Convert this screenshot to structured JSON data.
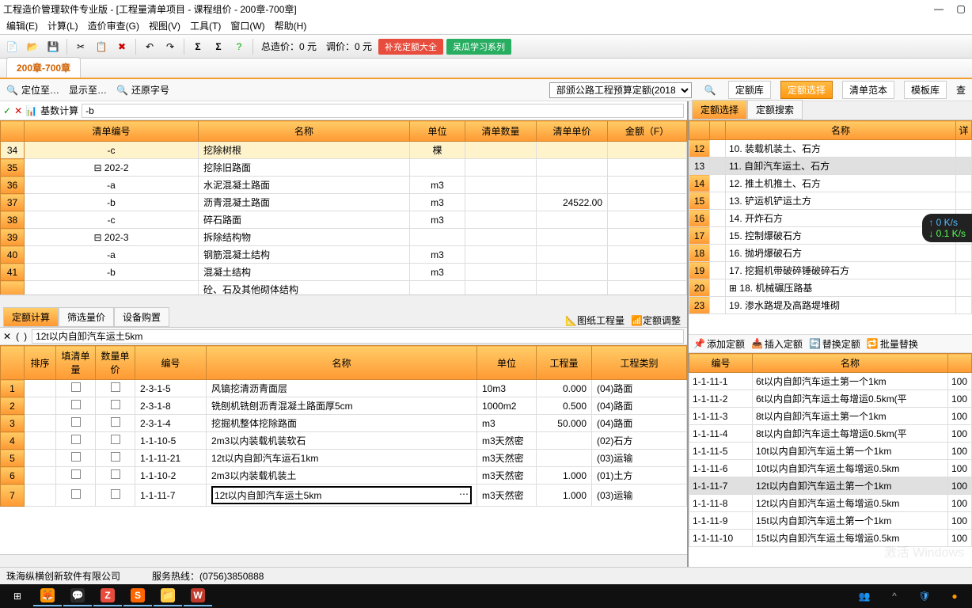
{
  "titlebar": {
    "title": "工程造价管理软件专业版 - [工程量清单项目 - 课程组价 - 200章-700章]"
  },
  "menu": [
    "编辑(E)",
    "计算(L)",
    "造价审查(G)",
    "视图(V)",
    "工具(T)",
    "窗口(W)",
    "帮助(H)"
  ],
  "toolbar": {
    "total_price": "总造价：0 元",
    "adj_price": "调价：0 元",
    "badge1": "补充定额大全",
    "badge2": "呆瓜学习系列"
  },
  "doctab": "200章-700章",
  "filterbar": {
    "locate": "定位至…",
    "show": "显示至…",
    "restore": "还原字号",
    "dropdown": "部颁公路工程预算定额(2018)",
    "btn_lib": "定额库",
    "btn_sel": "定额选择",
    "btn_tmpl1": "清单范本",
    "btn_tmpl2": "模板库",
    "btn_more": "查"
  },
  "formula": {
    "label": "基数计算",
    "value": "-b"
  },
  "maingrid": {
    "headers": [
      "",
      "清单编号",
      "名称",
      "单位",
      "清单数量",
      "清单单价",
      "金额（F）"
    ],
    "rows": [
      {
        "n": "34",
        "code": "-c",
        "name": "挖除树根",
        "unit": "棵",
        "qty": "",
        "price": "",
        "amt": "",
        "sel": true
      },
      {
        "n": "35",
        "code": "⊟ 202-2",
        "name": "挖除旧路面",
        "unit": "",
        "qty": "",
        "price": "",
        "amt": ""
      },
      {
        "n": "36",
        "code": "-a",
        "name": "水泥混凝土路面",
        "unit": "m3",
        "qty": "",
        "price": "",
        "amt": ""
      },
      {
        "n": "37",
        "code": "-b",
        "name": "沥青混凝土路面",
        "unit": "m3",
        "qty": "",
        "price": "24522.00",
        "amt": ""
      },
      {
        "n": "38",
        "code": "-c",
        "name": "碎石路面",
        "unit": "m3",
        "qty": "",
        "price": "",
        "amt": ""
      },
      {
        "n": "39",
        "code": "⊟ 202-3",
        "name": "拆除结构物",
        "unit": "",
        "qty": "",
        "price": "",
        "amt": ""
      },
      {
        "n": "40",
        "code": "-a",
        "name": "钢筋混凝土结构",
        "unit": "m3",
        "qty": "",
        "price": "",
        "amt": ""
      },
      {
        "n": "41",
        "code": "-b",
        "name": "混凝土结构",
        "unit": "m3",
        "qty": "",
        "price": "",
        "amt": ""
      },
      {
        "n": "",
        "code": "",
        "name": "砼、石及其他砌体结构",
        "unit": "",
        "qty": "",
        "price": "",
        "amt": ""
      }
    ]
  },
  "bottomtabs": {
    "tabs": [
      "定额计算",
      "筛选量价",
      "设备购置"
    ],
    "right1": "图纸工程量",
    "right2": "定额调整"
  },
  "calcbar": {
    "value": "12t以内自卸汽车运土5km"
  },
  "calcgrid": {
    "headers": [
      "排序",
      "填清单量",
      "数量单价",
      "编号",
      "名称",
      "单位",
      "工程量",
      "工程类别"
    ],
    "rows": [
      {
        "n": "1",
        "code": "2-3-1-5",
        "name": "风镐挖清沥青面层",
        "unit": "10m3",
        "qty": "0.000",
        "cat": "(04)路面"
      },
      {
        "n": "2",
        "code": "2-3-1-8",
        "name": "铣刨机铣刨沥青混凝土路面厚5cm",
        "unit": "1000m2",
        "qty": "0.500",
        "cat": "(04)路面"
      },
      {
        "n": "3",
        "code": "2-3-1-4",
        "name": "挖掘机整体挖除路面",
        "unit": "m3",
        "qty": "50.000",
        "cat": "(04)路面"
      },
      {
        "n": "4",
        "code": "1-1-10-5",
        "name": "2m3以内装载机装软石",
        "unit": "m3天然密",
        "qty": "",
        "cat": "(02)石方"
      },
      {
        "n": "5",
        "code": "1-1-11-21",
        "name": "12t以内自卸汽车运石1km",
        "unit": "m3天然密",
        "qty": "",
        "cat": "(03)运输"
      },
      {
        "n": "6",
        "code": "1-1-10-2",
        "name": "2m3以内装载机装土",
        "unit": "m3天然密",
        "qty": "1.000",
        "cat": "(01)土方"
      },
      {
        "n": "7",
        "code": "1-1-11-7",
        "name": "12t以内自卸汽车运土5km",
        "unit": "m3天然密",
        "qty": "1.000",
        "cat": "(03)运输",
        "edit": true
      }
    ]
  },
  "righttabs": [
    "定额选择",
    "定额搜索"
  ],
  "rightgrid1": {
    "header": "名称",
    "rows": [
      {
        "n": "12",
        "name": "10. 装载机装土、石方"
      },
      {
        "n": "13",
        "name": "11. 自卸汽车运土、石方",
        "sel": true
      },
      {
        "n": "14",
        "name": "12. 推土机推土、石方"
      },
      {
        "n": "15",
        "name": "13. 铲运机铲运土方"
      },
      {
        "n": "16",
        "name": "14. 开炸石方"
      },
      {
        "n": "17",
        "name": "15. 控制爆破石方"
      },
      {
        "n": "18",
        "name": "16. 抛坍爆破石方"
      },
      {
        "n": "19",
        "name": "17. 挖掘机带破碎锤破碎石方"
      },
      {
        "n": "20",
        "name": "⊞ 18. 机械碾压路基"
      },
      {
        "n": "23",
        "name": "19. 渗水路堤及高路堤堆砌"
      }
    ]
  },
  "righttoolbar": [
    "添加定额",
    "插入定额",
    "替换定额",
    "批量替换"
  ],
  "rightgrid2": {
    "headers": [
      "编号",
      "名称"
    ],
    "rows": [
      {
        "code": "1-1-11-1",
        "name": "6t以内自卸汽车运土第一个1km",
        "r": "100"
      },
      {
        "code": "1-1-11-2",
        "name": "6t以内自卸汽车运土每增运0.5km(平",
        "r": "100"
      },
      {
        "code": "1-1-11-3",
        "name": "8t以内自卸汽车运土第一个1km",
        "r": "100"
      },
      {
        "code": "1-1-11-4",
        "name": "8t以内自卸汽车运土每增运0.5km(平",
        "r": "100"
      },
      {
        "code": "1-1-11-5",
        "name": "10t以内自卸汽车运土第一个1km",
        "r": "100"
      },
      {
        "code": "1-1-11-6",
        "name": "10t以内自卸汽车运土每增运0.5km",
        "r": "100"
      },
      {
        "code": "1-1-11-7",
        "name": "12t以内自卸汽车运土第一个1km",
        "r": "100",
        "sel": true
      },
      {
        "code": "1-1-11-8",
        "name": "12t以内自卸汽车运土每增运0.5km",
        "r": "100"
      },
      {
        "code": "1-1-11-9",
        "name": "15t以内自卸汽车运土第一个1km",
        "r": "100"
      },
      {
        "code": "1-1-11-10",
        "name": "15t以内自卸汽车运土每增运0.5km",
        "r": "100"
      }
    ]
  },
  "statusbar": {
    "company": "珠海纵横创新软件有限公司",
    "hotline": "服务热线：(0756)3850888"
  },
  "speed": {
    "up": "↑  0 K/s",
    "dn": "↓ 0.1 K/s"
  },
  "watermark": "激活 Windows"
}
